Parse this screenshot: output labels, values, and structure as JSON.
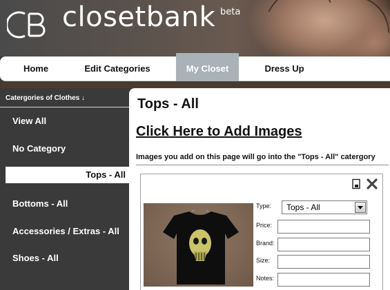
{
  "brand": {
    "logo_text": "CB",
    "name": "closetbank",
    "badge": "beta"
  },
  "nav": {
    "items": [
      {
        "label": "Home"
      },
      {
        "label": "Edit Categories"
      },
      {
        "label": "My Closet",
        "active": true
      },
      {
        "label": "Dress Up"
      }
    ]
  },
  "sidebar": {
    "header": "Catergories of Clothes ↓",
    "items": [
      {
        "label": "View All"
      },
      {
        "label": "No Category"
      },
      {
        "label": "Tops - All",
        "active": true
      },
      {
        "label": "Bottoms - All"
      },
      {
        "label": "Accessories / Extras - All"
      },
      {
        "label": "Shoes - All"
      }
    ]
  },
  "main": {
    "title": "Tops - All",
    "add_images_link": "Click Here to Add Images",
    "info": "Images you add on this page will go into the \"Tops - All\" catergory"
  },
  "item_card": {
    "icons": [
      "page-icon",
      "close-icon"
    ],
    "photo_subject": "black-t-shirt-with-skull-print",
    "fields": {
      "type_label": "Type:",
      "type_value": "Tops - All",
      "price_label": "Price:",
      "price_value": "",
      "brand_label": "Brand:",
      "brand_value": "",
      "size_label": "Size:",
      "size_value": "",
      "notes_label": "Notes:",
      "notes_value": ""
    }
  },
  "colors": {
    "nav_active": "#a9b1b9",
    "sidebar_bg": "#3a3a3a",
    "main_bg": "#ffffff"
  }
}
